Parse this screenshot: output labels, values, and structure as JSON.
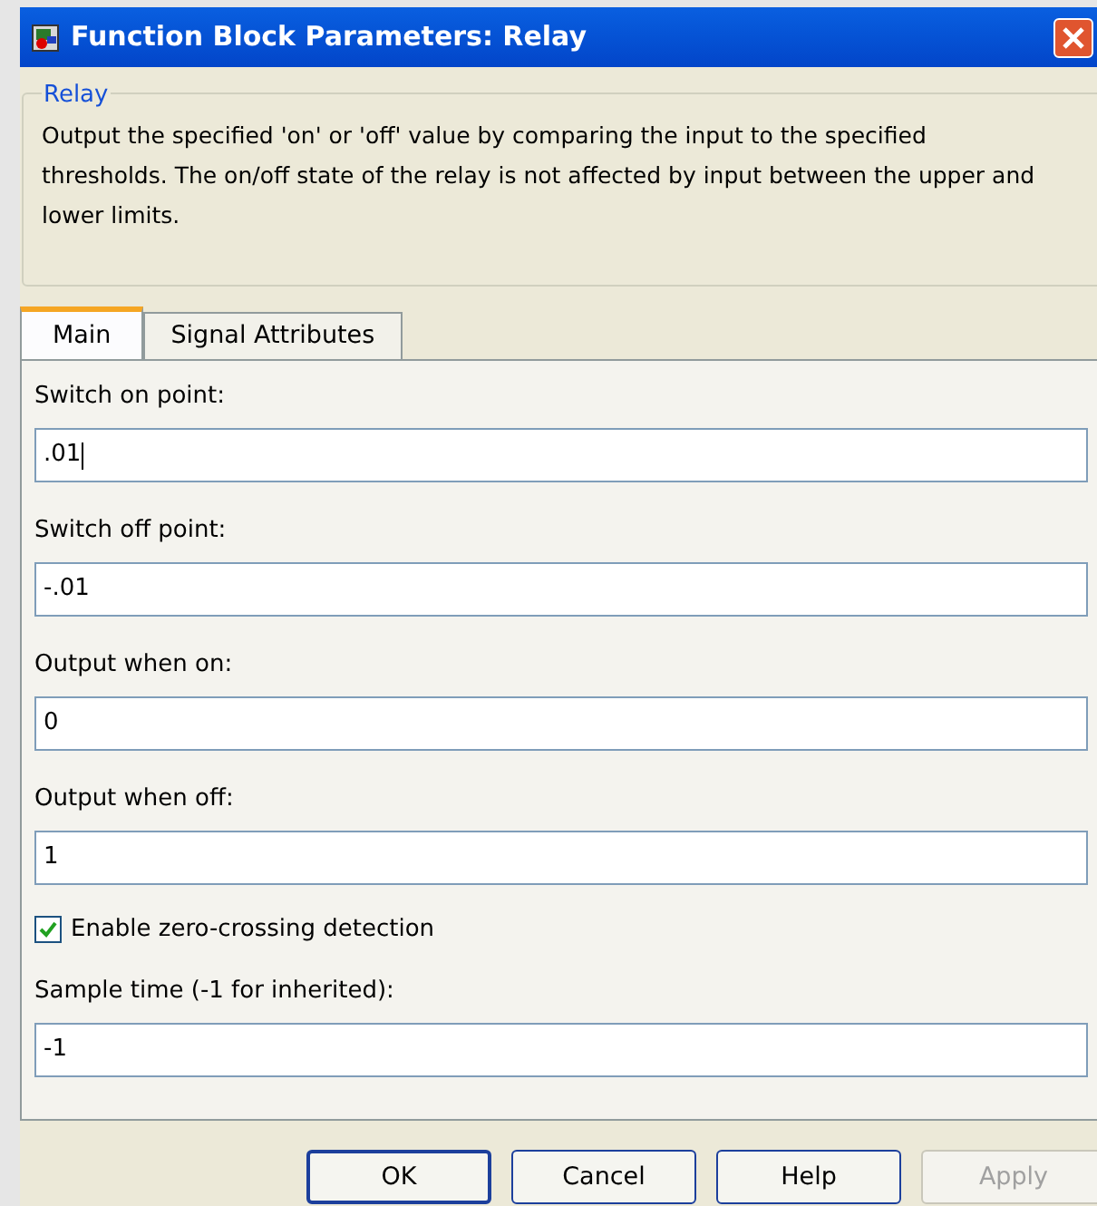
{
  "window": {
    "title": "Function Block Parameters: Relay"
  },
  "group": {
    "title": "Relay",
    "description": "Output the specified 'on' or 'off' value by comparing the input to the specified thresholds.  The on/off state of the relay is not affected by input between the upper and lower limits."
  },
  "tabs": [
    {
      "label": "Main",
      "selected": true
    },
    {
      "label": "Signal Attributes",
      "selected": false
    }
  ],
  "parameters": [
    {
      "kind": "field",
      "label": "Switch on point:",
      "value": ".01",
      "focused": true
    },
    {
      "kind": "field",
      "label": "Switch off point:",
      "value": "-.01",
      "focused": false
    },
    {
      "kind": "field",
      "label": "Output when on:",
      "value": "0",
      "focused": false
    },
    {
      "kind": "field",
      "label": "Output when off:",
      "value": "1",
      "focused": false
    },
    {
      "kind": "checkbox",
      "label": "Enable zero-crossing detection",
      "checked": true
    },
    {
      "kind": "field",
      "label": "Sample time (-1 for inherited):",
      "value": "-1",
      "focused": false
    }
  ],
  "buttons": [
    {
      "label": "OK",
      "default": true,
      "disabled": false
    },
    {
      "label": "Cancel",
      "default": false,
      "disabled": false
    },
    {
      "label": "Help",
      "default": false,
      "disabled": false
    },
    {
      "label": "Apply",
      "default": false,
      "disabled": true
    }
  ]
}
